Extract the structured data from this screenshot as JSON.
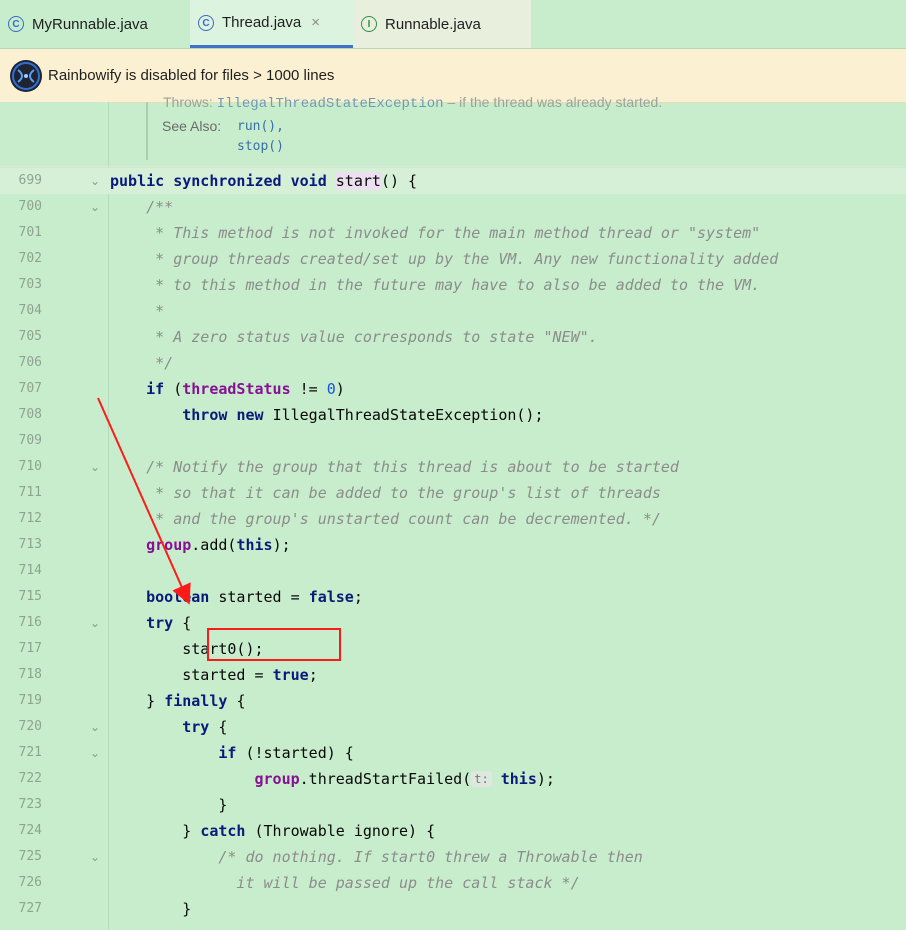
{
  "tabs": [
    {
      "label": "MyRunnable.java",
      "icon": "class-icon",
      "icon_glyph": "C",
      "closable": false
    },
    {
      "label": "Thread.java",
      "icon": "class-icon",
      "icon_glyph": "C",
      "closable": true,
      "close_glyph": "×"
    },
    {
      "label": "Runnable.java",
      "icon": "interface-icon",
      "icon_glyph": "I",
      "closable": false
    }
  ],
  "banner": {
    "text": "Rainbowify is disabled for files > 1000 lines"
  },
  "doc": {
    "cut_text": "Throws:",
    "cut_mono": "IllegalThreadStateException",
    "cut_rest": "– if the thread was already started.",
    "see_also_label": "See Also:",
    "see_also_links": [
      "run(),",
      "stop()"
    ]
  },
  "code_lines": [
    {
      "num": "699",
      "fold": "⌄",
      "segs": [
        [
          "kw",
          "public "
        ],
        [
          "kw",
          "synchronized "
        ],
        [
          "kw",
          "void "
        ],
        [
          "hl",
          "start"
        ],
        [
          "",
          "() {"
        ]
      ]
    },
    {
      "num": "700",
      "fold": "⌄",
      "segs": [
        [
          "cm",
          "    /**"
        ]
      ]
    },
    {
      "num": "701",
      "fold": "",
      "segs": [
        [
          "cm",
          "     * This method is not invoked for the main method thread or \"system\""
        ]
      ]
    },
    {
      "num": "702",
      "fold": "",
      "segs": [
        [
          "cm",
          "     * group threads created/set up by the VM. Any new functionality added"
        ]
      ]
    },
    {
      "num": "703",
      "fold": "",
      "segs": [
        [
          "cm",
          "     * to this method in the future may have to also be added to the VM."
        ]
      ]
    },
    {
      "num": "704",
      "fold": "",
      "segs": [
        [
          "cm",
          "     *"
        ]
      ]
    },
    {
      "num": "705",
      "fold": "",
      "segs": [
        [
          "cm",
          "     * A zero status value corresponds to state \"NEW\"."
        ]
      ]
    },
    {
      "num": "706",
      "fold": "",
      "segs": [
        [
          "cm",
          "     */"
        ]
      ]
    },
    {
      "num": "707",
      "fold": "",
      "segs": [
        [
          "",
          "    "
        ],
        [
          "kw",
          "if "
        ],
        [
          "",
          "("
        ],
        [
          "fld",
          "threadStatus"
        ],
        [
          "",
          " != "
        ],
        [
          "num",
          "0"
        ],
        [
          "",
          ")"
        ]
      ]
    },
    {
      "num": "708",
      "fold": "",
      "segs": [
        [
          "",
          "        "
        ],
        [
          "kw",
          "throw "
        ],
        [
          "kw",
          "new "
        ],
        [
          "",
          "IllegalThreadStateException();"
        ]
      ]
    },
    {
      "num": "709",
      "fold": "",
      "segs": [
        [
          "",
          ""
        ]
      ]
    },
    {
      "num": "710",
      "fold": "⌄",
      "segs": [
        [
          "cm",
          "    /* Notify the group that this thread is about to be started"
        ]
      ]
    },
    {
      "num": "711",
      "fold": "",
      "segs": [
        [
          "cm",
          "     * so that it can be added to the group's list of threads"
        ]
      ]
    },
    {
      "num": "712",
      "fold": "",
      "segs": [
        [
          "cm",
          "     * and the group's unstarted count can be decremented. */"
        ]
      ]
    },
    {
      "num": "713",
      "fold": "",
      "segs": [
        [
          "",
          "    "
        ],
        [
          "fld",
          "group"
        ],
        [
          "",
          ".add("
        ],
        [
          "kw",
          "this"
        ],
        [
          "",
          ");"
        ]
      ]
    },
    {
      "num": "714",
      "fold": "",
      "segs": [
        [
          "",
          ""
        ]
      ]
    },
    {
      "num": "715",
      "fold": "",
      "segs": [
        [
          "",
          "    "
        ],
        [
          "kw",
          "boolean "
        ],
        [
          "",
          "started = "
        ],
        [
          "kw",
          "false"
        ],
        [
          "",
          ";"
        ]
      ]
    },
    {
      "num": "716",
      "fold": "⌄",
      "segs": [
        [
          "",
          "    "
        ],
        [
          "kw",
          "try "
        ],
        [
          "",
          "{"
        ]
      ]
    },
    {
      "num": "717",
      "fold": "",
      "segs": [
        [
          "",
          "        start0();"
        ]
      ]
    },
    {
      "num": "718",
      "fold": "",
      "segs": [
        [
          "",
          "        started = "
        ],
        [
          "kw",
          "true"
        ],
        [
          "",
          ";"
        ]
      ]
    },
    {
      "num": "719",
      "fold": "",
      "segs": [
        [
          "",
          "    } "
        ],
        [
          "kw",
          "finally "
        ],
        [
          "",
          "{"
        ]
      ]
    },
    {
      "num": "720",
      "fold": "⌄",
      "segs": [
        [
          "",
          "        "
        ],
        [
          "kw",
          "try "
        ],
        [
          "",
          "{"
        ]
      ]
    },
    {
      "num": "721",
      "fold": "⌄",
      "segs": [
        [
          "",
          "            "
        ],
        [
          "kw",
          "if "
        ],
        [
          "",
          "(!started) {"
        ]
      ]
    },
    {
      "num": "722",
      "fold": "",
      "segs": [
        [
          "",
          "                "
        ],
        [
          "fld",
          "group"
        ],
        [
          "",
          ".threadStartFailed("
        ],
        [
          "hint",
          "t:"
        ],
        [
          "kw",
          " this"
        ],
        [
          "",
          ");"
        ]
      ]
    },
    {
      "num": "723",
      "fold": "",
      "segs": [
        [
          "",
          "            }"
        ]
      ]
    },
    {
      "num": "724",
      "fold": "",
      "segs": [
        [
          "",
          "        } "
        ],
        [
          "kw",
          "catch "
        ],
        [
          "",
          "(Throwable ignore) {"
        ]
      ]
    },
    {
      "num": "725",
      "fold": "⌄",
      "segs": [
        [
          "cm",
          "            /* do nothing. If start0 threw a Throwable then"
        ]
      ]
    },
    {
      "num": "726",
      "fold": "",
      "segs": [
        [
          "cm",
          "              it will be passed up the call stack */"
        ]
      ]
    },
    {
      "num": "727",
      "fold": "",
      "segs": [
        [
          "",
          "        }"
        ]
      ]
    }
  ],
  "colors": {
    "annotation": "#ff1a1a",
    "editor_bg": "#c7edcc",
    "banner_bg": "#fbf1d2",
    "tab_active_underline": "#3f73c9"
  }
}
